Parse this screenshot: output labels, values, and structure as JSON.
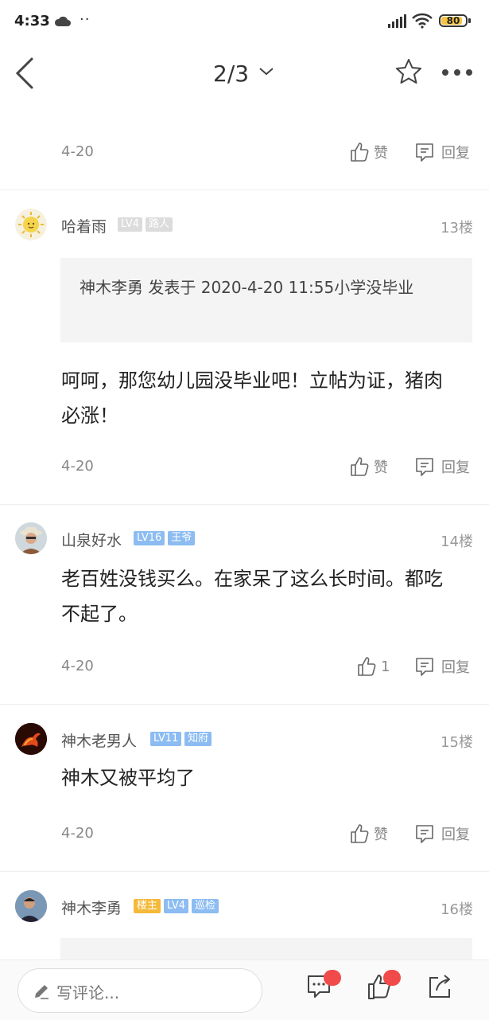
{
  "status_bar": {
    "time": "4:33",
    "dots": "··",
    "battery": "80"
  },
  "nav": {
    "pager": "2/3"
  },
  "prev_post": {
    "date": "4-20",
    "like_label": "赞",
    "reply_label": "回复"
  },
  "posts": [
    {
      "name": "哈着雨",
      "badges": [
        "LV4",
        "路人"
      ],
      "floor": "13楼",
      "quote": "神木李勇 发表于 2020-4-20 11:55小学没毕业",
      "body": "呵呵，那您幼儿园没毕业吧！立帖为证，猪肉必涨！",
      "date": "4-20",
      "like_label": "赞",
      "reply_label": "回复"
    },
    {
      "name": "山泉好水",
      "badges": [
        "LV16",
        "王爷"
      ],
      "floor": "14楼",
      "body": "老百姓没钱买么。在家呆了这么长时间。都吃不起了。",
      "date": "4-20",
      "like_label": "1",
      "reply_label": "回复"
    },
    {
      "name": "神木老男人",
      "badges": [
        "LV11",
        "知府"
      ],
      "floor": "15楼",
      "body": "神木又被平均了",
      "date": "4-20",
      "like_label": "赞",
      "reply_label": "回复"
    },
    {
      "name": "神木李勇",
      "badges": [
        "楼主",
        "LV4",
        "巡检"
      ],
      "floor": "16楼"
    }
  ],
  "bottom_bar": {
    "comment_placeholder": "写评论..."
  },
  "colors": {
    "badge_gray": "#dcdcdc",
    "badge_blue": "#8cbcf2",
    "badge_orange": "#f5b93a",
    "notify_red": "#f04a4a"
  }
}
